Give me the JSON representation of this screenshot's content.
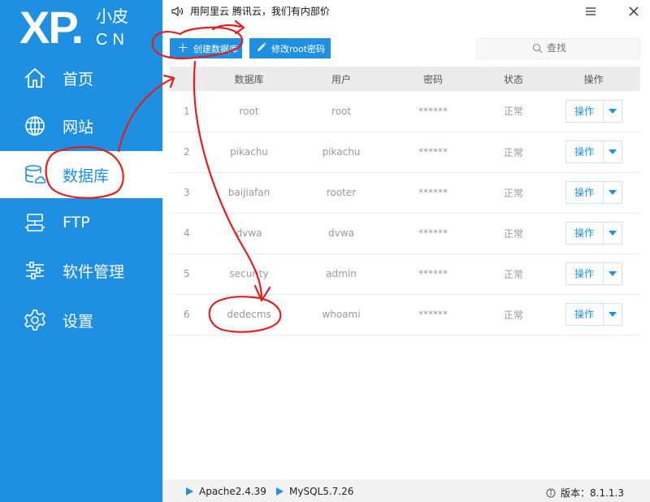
{
  "logo": {
    "main": "XP.",
    "sub_cn": "小皮",
    "sub_en": "CN"
  },
  "nav": [
    {
      "label": "首页",
      "icon": "home-icon"
    },
    {
      "label": "网站",
      "icon": "globe-icon"
    },
    {
      "label": "数据库",
      "icon": "database-icon",
      "active": true
    },
    {
      "label": "FTP",
      "icon": "server-icon"
    },
    {
      "label": "软件管理",
      "icon": "sliders-icon"
    },
    {
      "label": "设置",
      "icon": "gear-icon"
    }
  ],
  "topbar": {
    "ad_text": "用阿里云 腾讯云，我们有内部价"
  },
  "toolbar": {
    "create_label": "创建数据库",
    "change_root_label": "修改root密码",
    "search_placeholder": "查找"
  },
  "table": {
    "headers": {
      "num": "",
      "db": "数据库",
      "user": "用户",
      "password": "密码",
      "status": "状态",
      "action": "操作"
    },
    "rows": [
      {
        "num": "1",
        "db": "root",
        "user": "root",
        "password": "******",
        "status": "正常",
        "action": "操作"
      },
      {
        "num": "2",
        "db": "pikachu",
        "user": "pikachu",
        "password": "******",
        "status": "正常",
        "action": "操作"
      },
      {
        "num": "3",
        "db": "baijiafan",
        "user": "rooter",
        "password": "******",
        "status": "正常",
        "action": "操作"
      },
      {
        "num": "4",
        "db": "dvwa",
        "user": "dvwa",
        "password": "******",
        "status": "正常",
        "action": "操作"
      },
      {
        "num": "5",
        "db": "security",
        "user": "admin",
        "password": "******",
        "status": "正常",
        "action": "操作"
      },
      {
        "num": "6",
        "db": "dedecms",
        "user": "whoami",
        "password": "******",
        "status": "正常",
        "action": "操作"
      }
    ]
  },
  "statusbar": {
    "apache": "Apache2.4.39",
    "mysql": "MySQL5.7.26",
    "version": "版本：8.1.1.3"
  },
  "colors": {
    "brand": "#1e8fe1",
    "annotation": "#e02020"
  }
}
